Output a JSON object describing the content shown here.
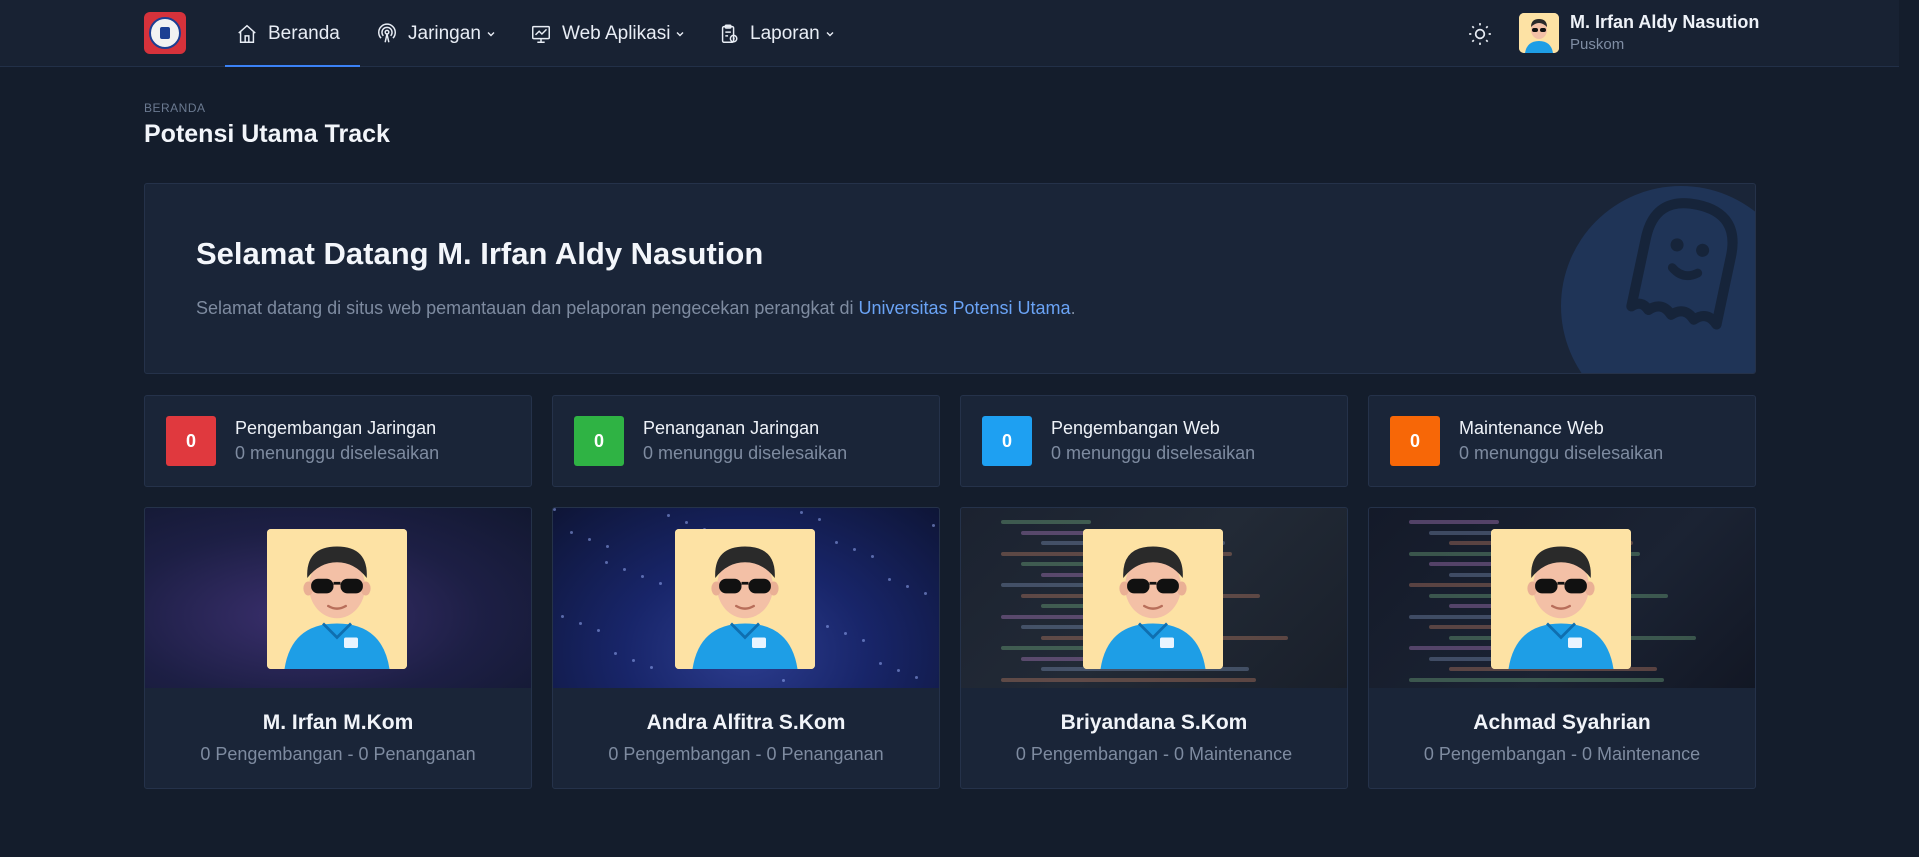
{
  "nav": {
    "items": [
      {
        "label": "Beranda",
        "icon": "home-icon"
      },
      {
        "label": "Jaringan",
        "icon": "broadcast-icon"
      },
      {
        "label": "Web Aplikasi",
        "icon": "monitor-chart-icon"
      },
      {
        "label": "Laporan",
        "icon": "clipboard-icon"
      }
    ],
    "theme_icon": "sun-icon"
  },
  "user": {
    "name": "M. Irfan Aldy Nasution",
    "role": "Puskom"
  },
  "page": {
    "breadcrumb": "BERANDA",
    "title": "Potensi Utama Track"
  },
  "welcome": {
    "title": "Selamat Datang M. Irfan Aldy Nasution",
    "text_before": "Selamat datang di situs web pemantauan dan pelaporan pengecekan perangkat di ",
    "link": "Universitas Potensi Utama",
    "text_after": "."
  },
  "stats": [
    {
      "count": "0",
      "label": "Pengembangan Jaringan",
      "sub": "0 menunggu diselesaikan",
      "color": "#e0393e"
    },
    {
      "count": "0",
      "label": "Penanganan Jaringan",
      "sub": "0 menunggu diselesaikan",
      "color": "#2fb344"
    },
    {
      "count": "0",
      "label": "Pengembangan Web",
      "sub": "0 menunggu diselesaikan",
      "color": "#1ea0f2"
    },
    {
      "count": "0",
      "label": "Maintenance Web",
      "sub": "0 menunggu diselesaikan",
      "color": "#f76707"
    }
  ],
  "team": [
    {
      "name": "M. Irfan M.Kom",
      "meta": "0 Pengembangan - 0 Penanganan"
    },
    {
      "name": "Andra Alfitra S.Kom",
      "meta": "0 Pengembangan - 0 Penanganan"
    },
    {
      "name": "Briyandana S.Kom",
      "meta": "0 Pengembangan - 0 Maintenance"
    },
    {
      "name": "Achmad Syahrian",
      "meta": "0 Pengembangan - 0 Maintenance"
    }
  ]
}
